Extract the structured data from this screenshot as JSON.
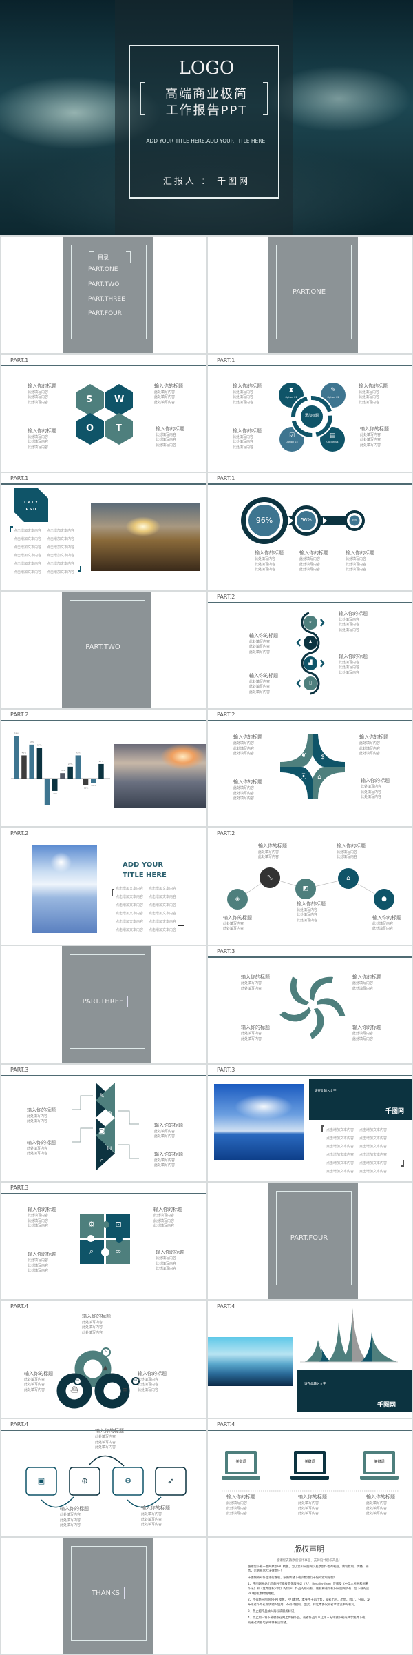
{
  "colors": {
    "teal": "#0f5468",
    "slate": "#4e7f7d",
    "deep": "#0c3340",
    "gray": "#3d3d3d"
  },
  "cover": {
    "logo": "LOGO",
    "title_line1": "高端商业极简",
    "title_line2": "工作报告PPT",
    "subtitle": "ADD YOUR TITLE HERE.ADD YOUR TITLE HERE.",
    "reporter": "汇报人 ： 千图网"
  },
  "toc": {
    "heading": "目录",
    "items": [
      "PART.ONE",
      "PART.TWO",
      "PART.THREE",
      "PART.FOUR"
    ]
  },
  "sections": {
    "one": "PART.ONE",
    "two": "PART.TWO",
    "three": "PART.THREE",
    "four": "PART.FOUR",
    "thanks": "THANKS"
  },
  "swot": {
    "part": "PART.1",
    "letters": [
      "S",
      "W",
      "O",
      "T"
    ],
    "blocks": [
      {
        "title": "输入你的标题",
        "lines": [
          "此处填写内容",
          "此处填写内容",
          "此处填写内容"
        ]
      },
      {
        "title": "输入你的标题",
        "lines": [
          "此处填写内容",
          "此处填写内容",
          "此处填写内容"
        ]
      },
      {
        "title": "输入你的标题",
        "lines": [
          "此处填写内容",
          "此处填写内容",
          "此处填写内容"
        ]
      },
      {
        "title": "输入你的标题",
        "lines": [
          "此处填写内容",
          "此处填写内容",
          "此处填写内容"
        ]
      }
    ]
  },
  "cycle": {
    "part": "PART.1",
    "center": "添加标题",
    "options": [
      "Option 01",
      "Option 02",
      "Option 03",
      "Option 04"
    ],
    "icons": [
      "hourglass-icon",
      "paperclip-icon",
      "edit-icon",
      "calendar-icon"
    ],
    "blocks": [
      {
        "title": "输入你的标题",
        "lines": [
          "此处填写内容",
          "此处填写内容",
          "此处填写内容"
        ]
      },
      {
        "title": "输入你的标题",
        "lines": [
          "此处填写内容",
          "此处填写内容",
          "此处填写内容"
        ]
      },
      {
        "title": "输入你的标题",
        "lines": [
          "此处填写内容",
          "此处填写内容",
          "此处填写内容"
        ]
      },
      {
        "title": "输入你的标题",
        "lines": [
          "此处填写内容",
          "此处填写内容",
          "此处填写内容"
        ]
      }
    ]
  },
  "calypso": {
    "part": "PART.1",
    "badge_line1": "C A L Y",
    "badge_line2": "P S O",
    "grid": [
      "点击增加文本内容",
      "点击增加文本内容",
      "点击增加文本内容",
      "点击增加文本内容",
      "点击增加文本内容",
      "点击增加文本内容",
      "点击增加文本内容",
      "点击增加文本内容",
      "点击增加文本内容",
      "点击增加文本内容",
      "点击增加文本内容",
      "点击增加文本内容"
    ]
  },
  "progress": {
    "part": "PART.1",
    "values": [
      96,
      56,
      26
    ],
    "labels": [
      "96%",
      "56%",
      "26%"
    ],
    "blocks": [
      {
        "title": "输入你的标题",
        "lines": [
          "此处填写内容",
          "此处填写内容",
          "此处填写内容"
        ]
      },
      {
        "title": "输入你的标题",
        "lines": [
          "此处填写内容",
          "此处填写内容",
          "此处填写内容"
        ]
      },
      {
        "title": "输入你的标题",
        "lines": [
          "此处填写内容",
          "此处填写内容",
          "此处填写内容"
        ]
      }
    ]
  },
  "wave": {
    "part": "PART.2",
    "icons": [
      "search-document-icon",
      "add-user-icon",
      "chart-icon",
      "document-icon"
    ],
    "blocks": [
      {
        "title": "输入你的标题",
        "lines": [
          "此处填写内容",
          "此处填写内容",
          "此处填写内容"
        ]
      },
      {
        "title": "输入你的标题",
        "lines": [
          "此处填写内容",
          "此处填写内容",
          "此处填写内容"
        ]
      },
      {
        "title": "输入你的标题",
        "lines": [
          "此处填写内容",
          "此处填写内容",
          "此处填写内容"
        ]
      },
      {
        "title": "输入你的标题",
        "lines": [
          "此处填写内容",
          "此处填写内容",
          "此处填写内容"
        ]
      }
    ]
  },
  "chart_data": {
    "type": "bar",
    "categories": [
      "1",
      "2",
      "3",
      "4",
      "5",
      "6",
      "7",
      "8",
      "9",
      "10",
      "11",
      "12"
    ],
    "values": [
      79,
      43,
      63,
      57,
      -50,
      -23,
      10,
      22,
      43,
      -12,
      -8,
      27
    ],
    "labels": [
      "79%",
      "43%",
      "63%",
      "57%",
      "",
      "-23%",
      "10%",
      "22%",
      "43%",
      "-12%",
      "-08%",
      "27%"
    ],
    "colors": [
      "#3e7590",
      "#3d3d3d",
      "#3e7590",
      "#0c3340",
      "#3e7590",
      "#0c3340",
      "#555a66",
      "#0c3340",
      "#3e7590",
      "#3d3d3d",
      "#3e7590",
      "#0c3340"
    ],
    "title": "",
    "xlabel": "",
    "ylabel": "",
    "grid": false
  },
  "barslide": {
    "part": "PART.2"
  },
  "star": {
    "part": "PART.2",
    "icons": [
      "brain-icon",
      "money-bag-icon",
      "signal-icon",
      "home-icon"
    ],
    "blocks": [
      {
        "title": "输入你的标题",
        "lines": [
          "此处填写内容",
          "此处填写内容",
          "此处填写内容"
        ]
      },
      {
        "title": "输入你的标题",
        "lines": [
          "此处填写内容",
          "此处填写内容",
          "此处填写内容"
        ]
      },
      {
        "title": "输入你的标题",
        "lines": [
          "此处填写内容",
          "此处填写内容",
          "此处填写内容"
        ]
      },
      {
        "title": "输入你的标题",
        "lines": [
          "此处填写内容",
          "此处填写内容",
          "此处填写内容"
        ]
      }
    ]
  },
  "addtitle": {
    "part": "PART.2",
    "title_line1": "ADD YOUR",
    "title_line2": "TITLE HERE",
    "grid": [
      "点击增加文本内容",
      "点击增加文本内容",
      "点击增加文本内容",
      "点击增加文本内容",
      "点击增加文本内容",
      "点击增加文本内容",
      "点击增加文本内容",
      "点击增加文本内容",
      "点击增加文本内容",
      "点击增加文本内容",
      "点击增加文本内容",
      "点击增加文本内容"
    ]
  },
  "network": {
    "part": "PART.2",
    "blocks": [
      {
        "title": "输入你的标题",
        "lines": [
          "此处填写内容",
          "此处填写内容"
        ]
      },
      {
        "title": "输入你的标题",
        "lines": [
          "此处填写内容",
          "此处填写内容"
        ]
      },
      {
        "title": "输入你的标题",
        "lines": [
          "此处填写内容",
          "此处填写内容"
        ]
      },
      {
        "title": "输入你的标题",
        "lines": [
          "此处填写内容",
          "此处填写内容",
          "此处填写内容"
        ]
      },
      {
        "title": "输入你的标题",
        "lines": [
          "此处填写内容",
          "此处填写内容"
        ]
      }
    ]
  },
  "pinwheel": {
    "part": "PART.3",
    "blocks": [
      {
        "title": "输入你的标题",
        "lines": [
          "此处填写内容",
          "此处填写内容"
        ]
      },
      {
        "title": "输入你的标题",
        "lines": [
          "此处填写内容",
          "此处填写内容"
        ]
      },
      {
        "title": "输入你的标题",
        "lines": [
          "此处填写内容",
          "此处填写内容"
        ]
      },
      {
        "title": "输入你的标题",
        "lines": [
          "此处填写内容",
          "此处填写内容"
        ]
      }
    ]
  },
  "triangles": {
    "part": "PART.3",
    "icons": [
      "pencil-icon",
      "globe-icon",
      "camera-icon",
      "cart-icon",
      "search-icon"
    ],
    "blocks": [
      {
        "title": "输入你的标题",
        "lines": [
          "此处填写内容",
          "此处填写内容"
        ]
      },
      {
        "title": "输入你的标题",
        "lines": [
          "此处填写内容",
          "此处填写内容"
        ]
      },
      {
        "title": "输入你的标题",
        "lines": [
          "此处填写内容",
          "此处填写内容"
        ]
      },
      {
        "title": "输入你的标题",
        "lines": [
          "此处填写内容",
          "此处填写内容"
        ]
      }
    ]
  },
  "sea": {
    "part": "PART.3",
    "caption": "请在此输入文字",
    "brand": "千图网",
    "grid": [
      "点击增加文本内容",
      "点击增加文本内容",
      "点击增加文本内容",
      "点击增加文本内容",
      "点击增加文本内容",
      "点击增加文本内容",
      "点击增加文本内容",
      "点击增加文本内容",
      "点击增加文本内容",
      "点击增加文本内容",
      "点击增加文本内容",
      "点击增加文本内容"
    ]
  },
  "puzzle": {
    "part": "PART.3",
    "icons": [
      "gear-icon",
      "lock-icon",
      "search-document-icon",
      "link-icon"
    ],
    "blocks": [
      {
        "title": "输入你的标题",
        "lines": [
          "此处填写内容",
          "此处填写内容",
          "此处填写内容"
        ]
      },
      {
        "title": "输入你的标题",
        "lines": [
          "此处填写内容",
          "此处填写内容",
          "此处填写内容"
        ]
      },
      {
        "title": "输入你的标题",
        "lines": [
          "此处填写内容",
          "此处填写内容",
          "此处填写内容"
        ]
      },
      {
        "title": "输入你的标题",
        "lines": [
          "此处填写内容",
          "此处填写内容",
          "此处填写内容"
        ]
      }
    ]
  },
  "rings": {
    "part": "PART.4",
    "numbers": [
      "01",
      "02",
      "03"
    ],
    "blocks": [
      {
        "title": "输入你的标题",
        "lines": [
          "此处填写内容",
          "此处填写内容",
          "此处填写内容"
        ]
      },
      {
        "title": "输入你的标题",
        "lines": [
          "此处填写内容",
          "此处填写内容",
          "此处填写内容"
        ]
      },
      {
        "title": "输入你的标题",
        "lines": [
          "此处填写内容",
          "此处填写内容",
          "此处填写内容"
        ]
      }
    ]
  },
  "mountains": {
    "part": "PART.4",
    "caption": "请在此输入文字",
    "brand": "千图网"
  },
  "steps": {
    "part": "PART.4",
    "icons": [
      "briefcase-icon",
      "globe-search-icon",
      "gears-icon",
      "rocket-icon"
    ],
    "blocks": [
      {
        "title": "输入你的标题",
        "lines": [
          "此处填写内容",
          "此处填写内容",
          "此处填写内容"
        ]
      },
      {
        "title": "输入你的标题",
        "lines": [
          "此处填写内容",
          "此处填写内容",
          "此处填写内容"
        ]
      },
      {
        "title": "输入你的标题",
        "lines": [
          "此处填写内容",
          "此处填写内容",
          "此处填写内容"
        ]
      }
    ]
  },
  "laptops": {
    "part": "PART.4",
    "keywords": [
      "关键词",
      "关键词",
      "关键词"
    ],
    "blocks": [
      {
        "title": "输入你的标题",
        "lines": [
          "此处填写内容",
          "此处填写内容",
          "此处填写内容"
        ]
      },
      {
        "title": "输入你的标题",
        "lines": [
          "此处填写内容",
          "此处填写内容",
          "此处填写内容"
        ]
      },
      {
        "title": "输入你的标题",
        "lines": [
          "此处填写内容",
          "此处填写内容",
          "此处填写内容"
        ]
      }
    ]
  },
  "copyright": {
    "title": "版权声明",
    "intro": "感谢您支持原创设计事业，支持设计版权产品！",
    "paragraphs": [
      "感谢您下载千图网原创PPT模板，为了您和千图网以及原创作者的利益，请勿复制、传播、销售，否则将承担法律责任！",
      "千图网将对作品进行维权，按照传播下载次数进行十倍的索取赔偿！",
      "1、千图网网站出售的PPT模板是免版税类（RF：Royalty-free）正版受《中华人民共和国著作法》和《世界版权公约》的保护，作品的所有权、版权和著作权归千图网所有，您下载的是PPT模板素材使用权。",
      "2、不得将千图网的PPT模板、PPT素材，本身用于再出售，或者出租、出借、转让、分销、发布或者作为礼物供他人使用，不得转授权、出卖、转让本协议或者本协议中的权利。",
      "3、禁止把作品纳入商标或服务标记。",
      "4、禁止用户将下载模板在网上传播作品，或者作品可以让第三方单独下载或共享免费下载，或通过转移电子邮件发送传播。"
    ]
  }
}
